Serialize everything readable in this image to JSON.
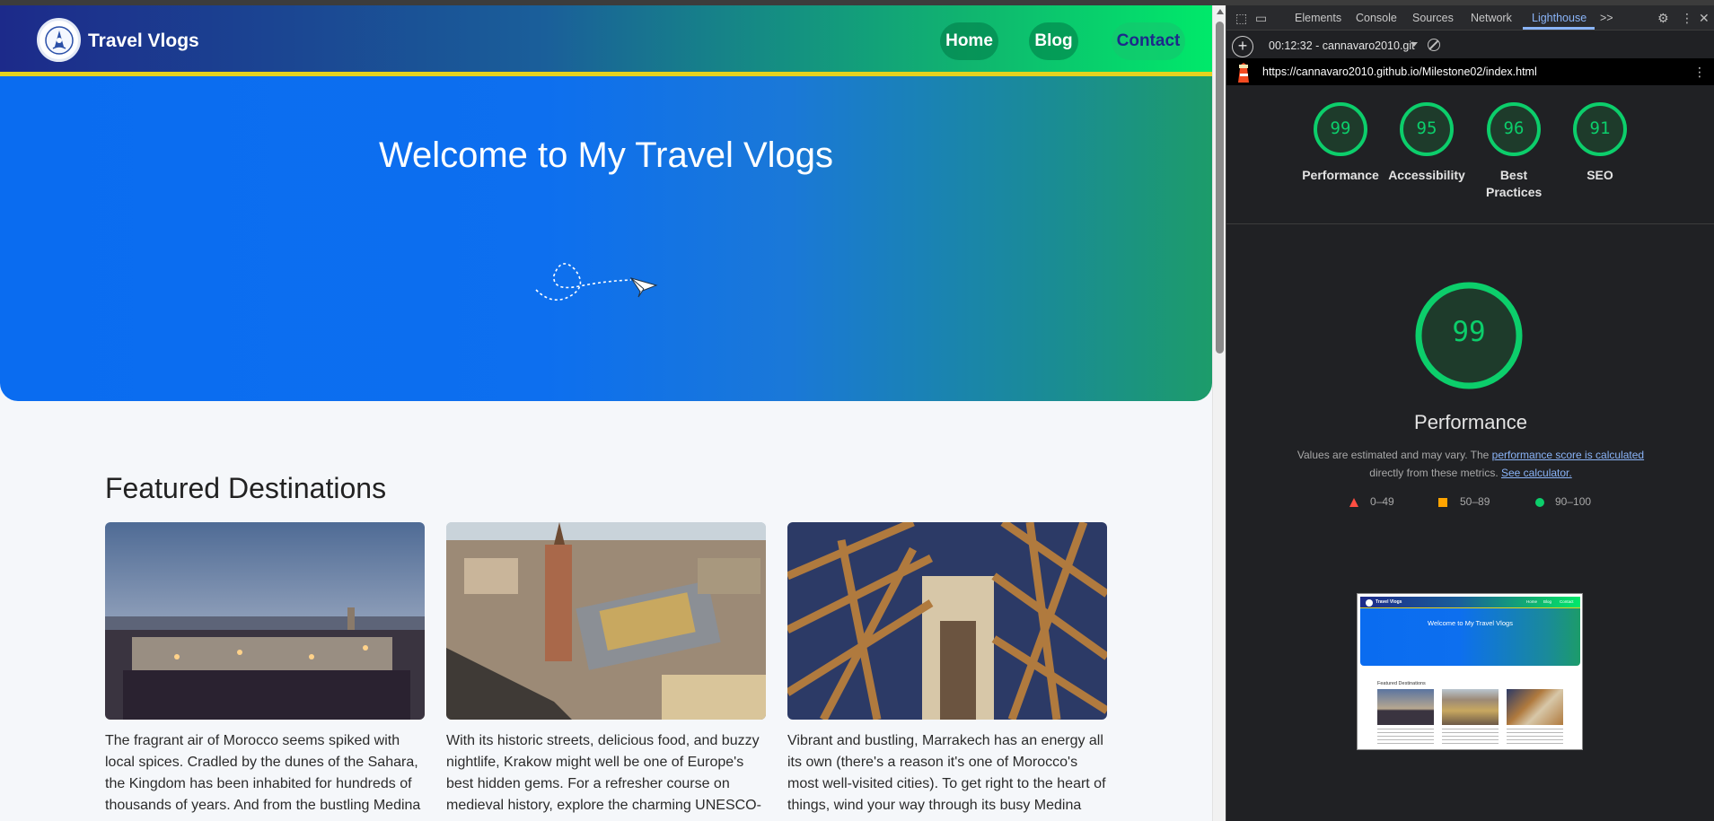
{
  "site": {
    "brand": "Travel Vlogs",
    "nav": {
      "home": "Home",
      "blog": "Blog",
      "contact": "Contact"
    },
    "hero_title": "Welcome to My Travel Vlogs",
    "featured_title": "Featured Destinations",
    "cards": [
      {
        "text": "The fragrant air of Morocco seems spiked with local spices. Cradled by the dunes of the Sahara, the Kingdom has been inhabited for hundreds of thousands of years. And from the bustling Medina"
      },
      {
        "text": "With its historic streets, delicious food, and buzzy nightlife, Krakow might well be one of Europe's best hidden gems. For a refresher course on medieval history, explore the charming UNESCO-"
      },
      {
        "text": "Vibrant and bustling, Marrakech has an energy all its own (there's a reason it's one of Morocco's most well-visited cities). To get right to the heart of things, wind your way through its busy Medina"
      }
    ]
  },
  "devtools": {
    "tabs": [
      "Elements",
      "Console",
      "Sources",
      "Network",
      "Lighthouse"
    ],
    "active_tab": "Lighthouse",
    "more_tabs": ">>",
    "session": "00:12:32 - cannavaro2010.git",
    "url": "https://cannavaro2010.github.io/Milestone02/index.html",
    "scores": [
      {
        "label": "Performance",
        "value": "99"
      },
      {
        "label": "Accessibility",
        "value": "95"
      },
      {
        "label": "Best Practices",
        "value": "96"
      },
      {
        "label": "SEO",
        "value": "91"
      }
    ],
    "main_score": "99",
    "main_title": "Performance",
    "note_prefix": "Values are estimated and may vary. The ",
    "note_link1": "performance score is calculated",
    "note_middle": "directly from these metrics.",
    "note_link2": "See calculator.",
    "legend": {
      "fail": "0–49",
      "average": "50–89",
      "pass": "90–100"
    },
    "colors": {
      "pass": "#0cce6b",
      "average": "#ffa400",
      "fail": "#ff4e42"
    },
    "thumbnail": {
      "brand": "Travel Vlogs",
      "nav": [
        "Home",
        "Blog",
        "Contact"
      ],
      "title": "Welcome to My Travel Vlogs",
      "featured": "Featured Destinations"
    }
  }
}
